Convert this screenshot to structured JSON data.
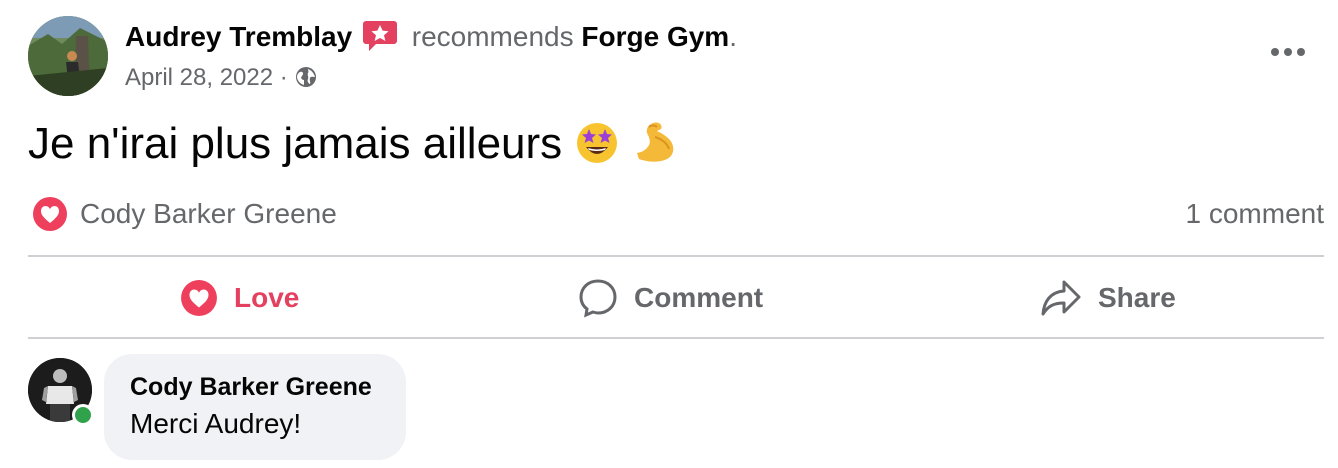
{
  "post": {
    "author_name": "Audrey Tremblay",
    "recommends_word": "recommends",
    "page_name": "Forge Gym",
    "period": ".",
    "date": "April 28, 2022",
    "date_separator": "·",
    "privacy_icon": "globe-icon",
    "text": "Je n'irai plus jamais ailleurs",
    "emojis": [
      "star-struck-emoji",
      "flexed-biceps-emoji"
    ]
  },
  "reactions": {
    "icon": "heart-icon",
    "reactor_name": "Cody Barker Greene",
    "comment_count": "1 comment"
  },
  "actions": {
    "love_label": "Love",
    "comment_label": "Comment",
    "share_label": "Share"
  },
  "comments": [
    {
      "author_name": "Cody Barker Greene",
      "text": "Merci Audrey!",
      "online": true
    }
  ],
  "colors": {
    "love_red": "#e4405f",
    "muted_text": "#65676b",
    "bubble_bg": "#f0f2f5",
    "divider": "#ced0d4",
    "online_green": "#31a24c"
  }
}
